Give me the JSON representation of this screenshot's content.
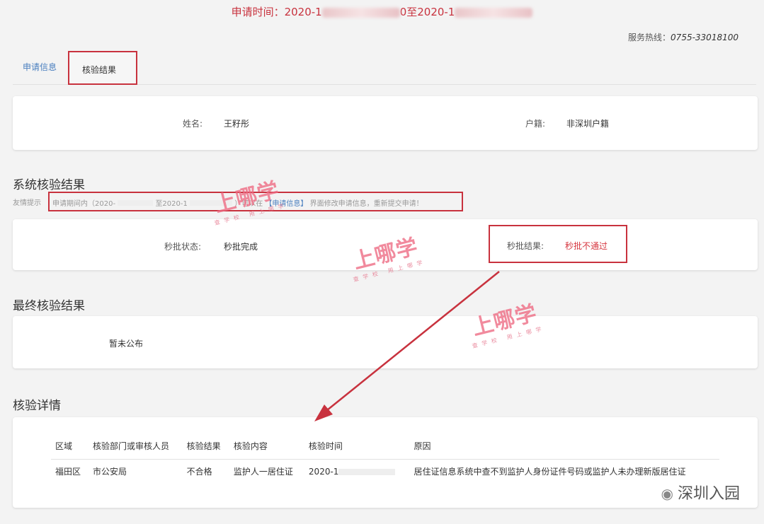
{
  "header": {
    "apply_time_label": "申请时间：2020-1",
    "apply_time_mid": "0至2020-1",
    "hotline_label": "服务热线：",
    "hotline_number": "0755-33018100"
  },
  "tabs": [
    {
      "label": "申请信息"
    },
    {
      "label": "核验结果"
    }
  ],
  "applicant": {
    "name_label": "姓名:",
    "name_value": "王籽彤",
    "hukou_label": "户籍:",
    "hukou_value": "非深圳户籍"
  },
  "system_result": {
    "title": "系统核验结果",
    "tip_label": "友情提示",
    "tip_text_1": "申请期间内（2020-",
    "tip_text_2": "至2020-1",
    "tip_text_3": "）可以在",
    "tip_link": "【申请信息】",
    "tip_text_4": "界面修改申请信息，重新提交申请！",
    "status_label": "秒批状态:",
    "status_value": "秒批完成",
    "result_label": "秒批结果:",
    "result_value": "秒批不通过"
  },
  "final_result": {
    "title": "最终核验结果",
    "value": "暂未公布"
  },
  "details": {
    "title": "核验详情",
    "columns": [
      "区域",
      "核验部门或审核人员",
      "核验结果",
      "核验内容",
      "核验时间",
      "原因"
    ],
    "rows": [
      [
        "福田区",
        "市公安局",
        "不合格",
        "监护人一居住证",
        "2020-1",
        "居住证信息系统中查不到监护人身份证件号码或监护人未办理新版居住证"
      ]
    ]
  },
  "watermark": {
    "big": "上哪学",
    "small": "查学校 用上哪学"
  },
  "brand": {
    "name": "深圳入园"
  },
  "colors": {
    "accent_red": "#c8323e",
    "fail_red": "#d6363f",
    "link_blue": "#4a7fbf"
  }
}
